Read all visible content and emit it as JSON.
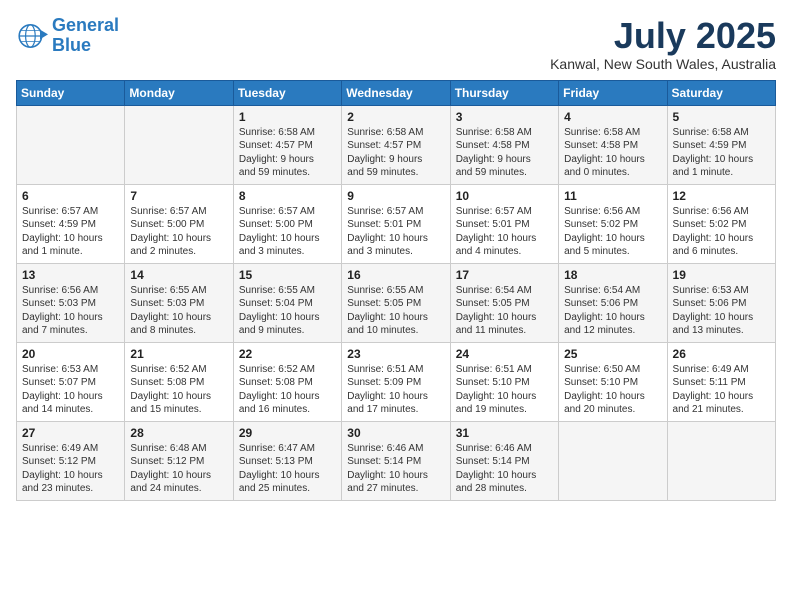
{
  "logo": {
    "line1": "General",
    "line2": "Blue"
  },
  "title": "July 2025",
  "location": "Kanwal, New South Wales, Australia",
  "days_header": [
    "Sunday",
    "Monday",
    "Tuesday",
    "Wednesday",
    "Thursday",
    "Friday",
    "Saturday"
  ],
  "weeks": [
    [
      {
        "day": "",
        "content": ""
      },
      {
        "day": "",
        "content": ""
      },
      {
        "day": "1",
        "content": "Sunrise: 6:58 AM\nSunset: 4:57 PM\nDaylight: 9 hours\nand 59 minutes."
      },
      {
        "day": "2",
        "content": "Sunrise: 6:58 AM\nSunset: 4:57 PM\nDaylight: 9 hours\nand 59 minutes."
      },
      {
        "day": "3",
        "content": "Sunrise: 6:58 AM\nSunset: 4:58 PM\nDaylight: 9 hours\nand 59 minutes."
      },
      {
        "day": "4",
        "content": "Sunrise: 6:58 AM\nSunset: 4:58 PM\nDaylight: 10 hours\nand 0 minutes."
      },
      {
        "day": "5",
        "content": "Sunrise: 6:58 AM\nSunset: 4:59 PM\nDaylight: 10 hours\nand 1 minute."
      }
    ],
    [
      {
        "day": "6",
        "content": "Sunrise: 6:57 AM\nSunset: 4:59 PM\nDaylight: 10 hours\nand 1 minute."
      },
      {
        "day": "7",
        "content": "Sunrise: 6:57 AM\nSunset: 5:00 PM\nDaylight: 10 hours\nand 2 minutes."
      },
      {
        "day": "8",
        "content": "Sunrise: 6:57 AM\nSunset: 5:00 PM\nDaylight: 10 hours\nand 3 minutes."
      },
      {
        "day": "9",
        "content": "Sunrise: 6:57 AM\nSunset: 5:01 PM\nDaylight: 10 hours\nand 3 minutes."
      },
      {
        "day": "10",
        "content": "Sunrise: 6:57 AM\nSunset: 5:01 PM\nDaylight: 10 hours\nand 4 minutes."
      },
      {
        "day": "11",
        "content": "Sunrise: 6:56 AM\nSunset: 5:02 PM\nDaylight: 10 hours\nand 5 minutes."
      },
      {
        "day": "12",
        "content": "Sunrise: 6:56 AM\nSunset: 5:02 PM\nDaylight: 10 hours\nand 6 minutes."
      }
    ],
    [
      {
        "day": "13",
        "content": "Sunrise: 6:56 AM\nSunset: 5:03 PM\nDaylight: 10 hours\nand 7 minutes."
      },
      {
        "day": "14",
        "content": "Sunrise: 6:55 AM\nSunset: 5:03 PM\nDaylight: 10 hours\nand 8 minutes."
      },
      {
        "day": "15",
        "content": "Sunrise: 6:55 AM\nSunset: 5:04 PM\nDaylight: 10 hours\nand 9 minutes."
      },
      {
        "day": "16",
        "content": "Sunrise: 6:55 AM\nSunset: 5:05 PM\nDaylight: 10 hours\nand 10 minutes."
      },
      {
        "day": "17",
        "content": "Sunrise: 6:54 AM\nSunset: 5:05 PM\nDaylight: 10 hours\nand 11 minutes."
      },
      {
        "day": "18",
        "content": "Sunrise: 6:54 AM\nSunset: 5:06 PM\nDaylight: 10 hours\nand 12 minutes."
      },
      {
        "day": "19",
        "content": "Sunrise: 6:53 AM\nSunset: 5:06 PM\nDaylight: 10 hours\nand 13 minutes."
      }
    ],
    [
      {
        "day": "20",
        "content": "Sunrise: 6:53 AM\nSunset: 5:07 PM\nDaylight: 10 hours\nand 14 minutes."
      },
      {
        "day": "21",
        "content": "Sunrise: 6:52 AM\nSunset: 5:08 PM\nDaylight: 10 hours\nand 15 minutes."
      },
      {
        "day": "22",
        "content": "Sunrise: 6:52 AM\nSunset: 5:08 PM\nDaylight: 10 hours\nand 16 minutes."
      },
      {
        "day": "23",
        "content": "Sunrise: 6:51 AM\nSunset: 5:09 PM\nDaylight: 10 hours\nand 17 minutes."
      },
      {
        "day": "24",
        "content": "Sunrise: 6:51 AM\nSunset: 5:10 PM\nDaylight: 10 hours\nand 19 minutes."
      },
      {
        "day": "25",
        "content": "Sunrise: 6:50 AM\nSunset: 5:10 PM\nDaylight: 10 hours\nand 20 minutes."
      },
      {
        "day": "26",
        "content": "Sunrise: 6:49 AM\nSunset: 5:11 PM\nDaylight: 10 hours\nand 21 minutes."
      }
    ],
    [
      {
        "day": "27",
        "content": "Sunrise: 6:49 AM\nSunset: 5:12 PM\nDaylight: 10 hours\nand 23 minutes."
      },
      {
        "day": "28",
        "content": "Sunrise: 6:48 AM\nSunset: 5:12 PM\nDaylight: 10 hours\nand 24 minutes."
      },
      {
        "day": "29",
        "content": "Sunrise: 6:47 AM\nSunset: 5:13 PM\nDaylight: 10 hours\nand 25 minutes."
      },
      {
        "day": "30",
        "content": "Sunrise: 6:46 AM\nSunset: 5:14 PM\nDaylight: 10 hours\nand 27 minutes."
      },
      {
        "day": "31",
        "content": "Sunrise: 6:46 AM\nSunset: 5:14 PM\nDaylight: 10 hours\nand 28 minutes."
      },
      {
        "day": "",
        "content": ""
      },
      {
        "day": "",
        "content": ""
      }
    ]
  ]
}
